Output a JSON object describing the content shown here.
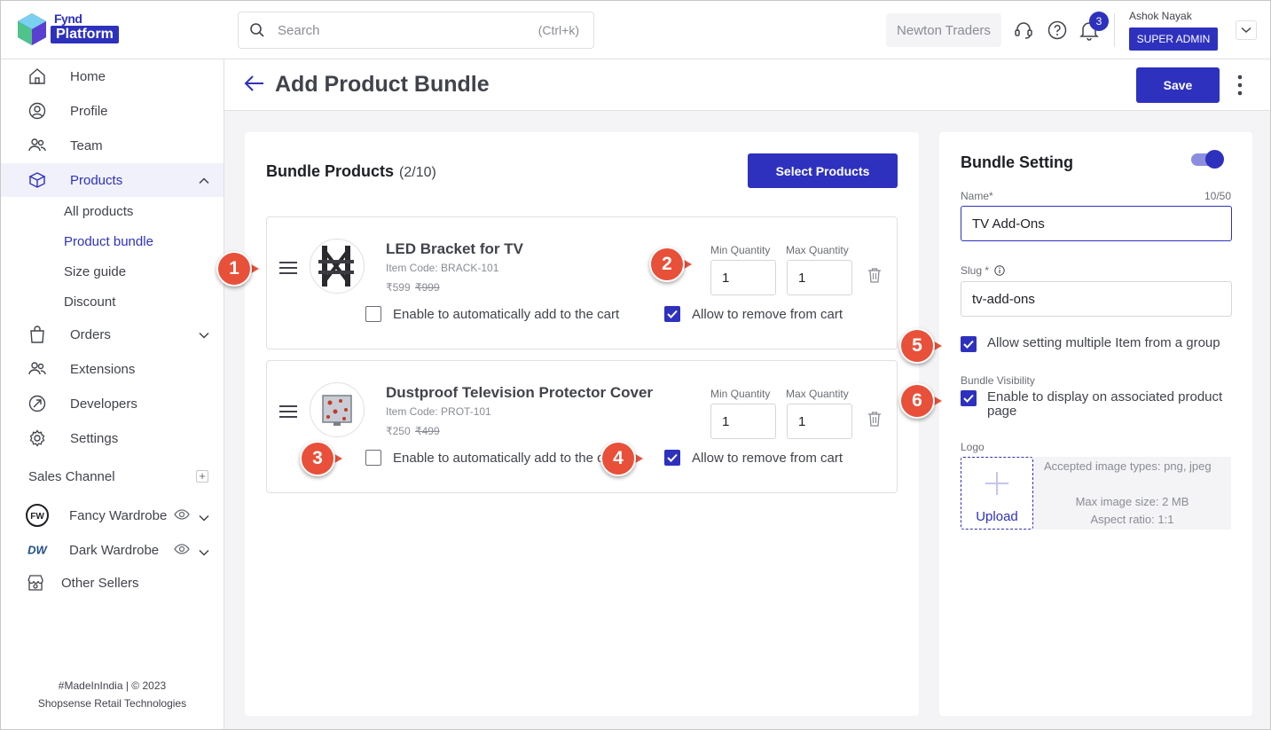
{
  "app": {
    "logo_line1": "Fynd",
    "logo_line2": "Platform"
  },
  "topbar": {
    "search_placeholder": "Search",
    "search_shortcut": "(Ctrl+k)",
    "company": "Newton Traders",
    "notification_count": "3",
    "user_name": "Ashok Nayak",
    "user_role": "SUPER ADMIN"
  },
  "sidebar": {
    "items": [
      {
        "label": "Home",
        "icon": "home-icon"
      },
      {
        "label": "Profile",
        "icon": "user-circle-icon"
      },
      {
        "label": "Team",
        "icon": "team-icon"
      },
      {
        "label": "Products",
        "icon": "box-icon"
      },
      {
        "label": "Orders",
        "icon": "bag-icon"
      },
      {
        "label": "Extensions",
        "icon": "extensions-icon"
      },
      {
        "label": "Developers",
        "icon": "developers-icon"
      },
      {
        "label": "Settings",
        "icon": "gear-icon"
      }
    ],
    "product_subitems": [
      "All products",
      "Product bundle",
      "Size guide",
      "Discount"
    ],
    "sales_channel_title": "Sales Channel",
    "channels": [
      {
        "label": "Fancy Wardrobe",
        "logo_text": "FW"
      },
      {
        "label": "Dark Wardrobe",
        "logo_text": "DW"
      }
    ],
    "other_sellers": "Other Sellers",
    "footer_line1": "#MadeInIndia | © 2023",
    "footer_line2": "Shopsense Retail Technologies"
  },
  "page": {
    "title": "Add Product Bundle",
    "save_label": "Save"
  },
  "bundle_products": {
    "title": "Bundle Products",
    "count": "(2/10)",
    "select_button": "Select Products",
    "min_qty_label": "Min Quantity",
    "max_qty_label": "Max Quantity",
    "auto_add_label": "Enable to automatically add to the cart",
    "auto_add_label_clipped": "Enable to automatically add to the c",
    "remove_label": "Allow to remove from cart",
    "items": [
      {
        "name": "LED Bracket for TV",
        "item_code": "Item Code: BRACK-101",
        "price": "₹599",
        "mrp": "₹999",
        "min_qty": "1",
        "max_qty": "1",
        "auto_add": false,
        "allow_remove": true
      },
      {
        "name": "Dustproof Television Protector Cover",
        "item_code": "Item Code: PROT-101",
        "price": "₹250",
        "mrp": "₹499",
        "min_qty": "1",
        "max_qty": "1",
        "auto_add": false,
        "allow_remove": true
      }
    ]
  },
  "bundle_setting": {
    "title": "Bundle Setting",
    "enabled": true,
    "name_label": "Name*",
    "name_counter": "10/50",
    "name_value": "TV Add-Ons",
    "slug_label": "Slug *",
    "slug_value": "tv-add-ons",
    "multiple_items_label": "Allow setting multiple Item from a group",
    "visibility_title": "Bundle Visibility",
    "display_label": "Enable to display on associated product page",
    "logo_label": "Logo",
    "upload_label": "Upload",
    "upload_info_1": "Accepted image types: png, jpeg",
    "upload_info_2": "Max image size: 2 MB",
    "upload_info_3": "Aspect ratio: 1:1"
  },
  "callouts": [
    "1",
    "2",
    "3",
    "4",
    "5",
    "6"
  ],
  "colors": {
    "primary": "#2e31be",
    "callout": "#e8503a",
    "background": "#f4f4f6"
  }
}
